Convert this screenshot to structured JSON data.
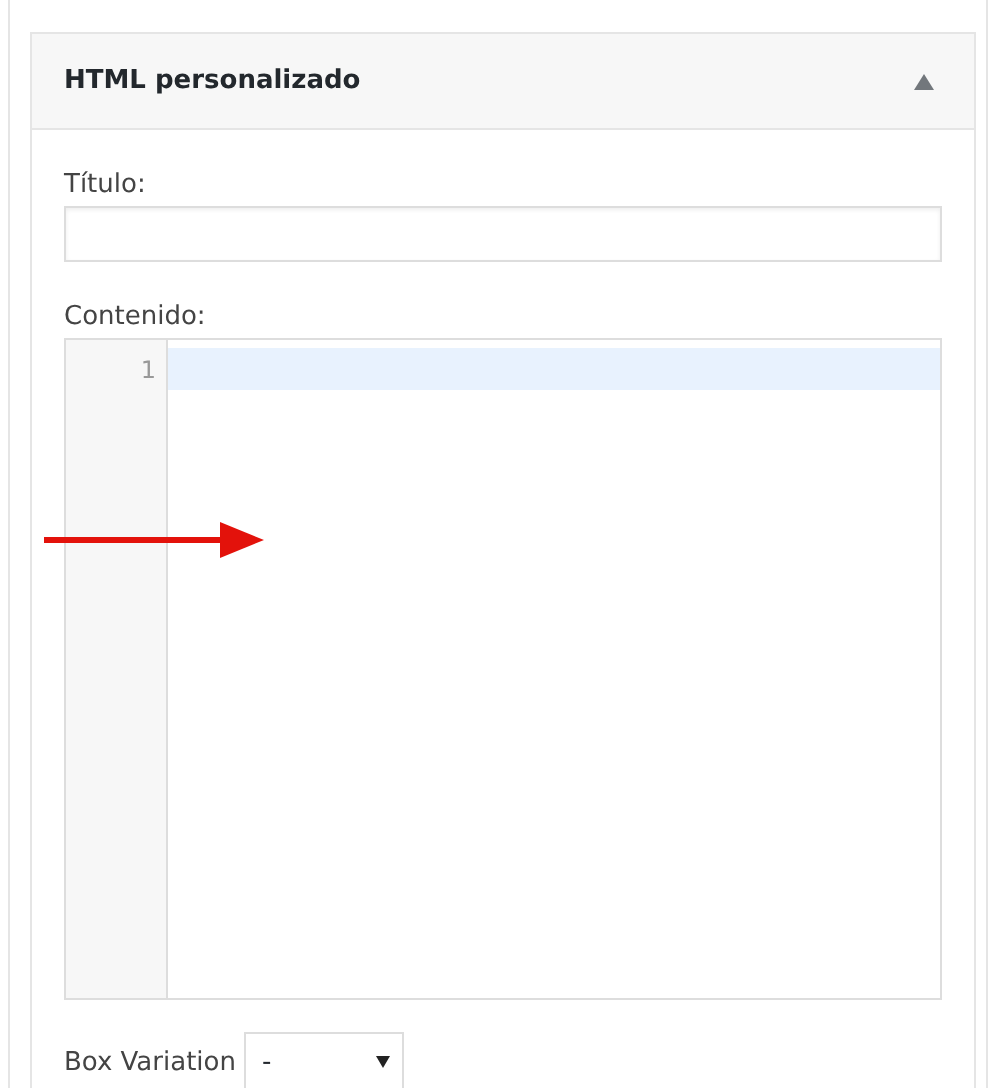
{
  "widget": {
    "title": "HTML personalizado",
    "expanded": true
  },
  "title_field": {
    "label": "Título:"
  },
  "content_editor": {
    "label": "Contenido:",
    "lines": [
      {
        "number": "1",
        "selected": true
      }
    ]
  },
  "box_variation": {
    "label": "Box Variation",
    "value": "-"
  }
}
